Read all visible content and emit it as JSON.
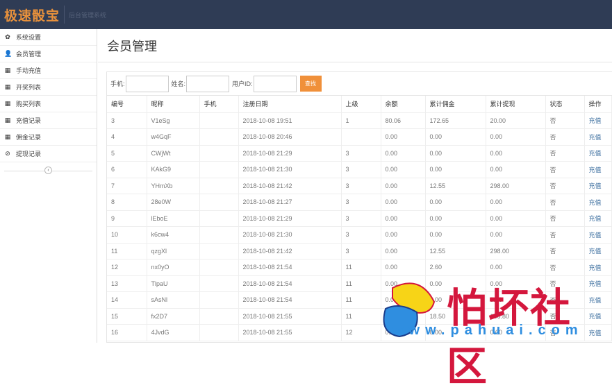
{
  "header": {
    "logo": "极速骰宝",
    "subtitle": "后台管理系统"
  },
  "sidebar": {
    "items": [
      {
        "icon": "gear-icon",
        "glyph": "✿",
        "label": "系统设置"
      },
      {
        "icon": "user-icon",
        "glyph": "👤",
        "label": "会员管理"
      },
      {
        "icon": "calendar-icon",
        "glyph": "▦",
        "label": "手动充值"
      },
      {
        "icon": "calendar-icon",
        "glyph": "▦",
        "label": "开奖列表"
      },
      {
        "icon": "calendar-icon",
        "glyph": "▦",
        "label": "购买列表"
      },
      {
        "icon": "calendar-icon",
        "glyph": "▦",
        "label": "充值记录"
      },
      {
        "icon": "calendar-icon",
        "glyph": "▦",
        "label": "佣金记录"
      },
      {
        "icon": "ban-icon",
        "glyph": "⊘",
        "label": "提现记录"
      }
    ],
    "collapse_glyph": "‹"
  },
  "page": {
    "title": "会员管理"
  },
  "search": {
    "phone_label": "手机:",
    "name_label": "姓名:",
    "uid_label": "用户ID:",
    "phone_value": "",
    "name_value": "",
    "uid_value": "",
    "button": "查找"
  },
  "table": {
    "headers": [
      "编号",
      "昵称",
      "手机",
      "注册日期",
      "上级",
      "余额",
      "累计佣金",
      "累计提现",
      "状态",
      "操作"
    ],
    "rows": [
      [
        "3",
        "V1eSg",
        "",
        "2018-10-08 19:51",
        "1",
        "80.06",
        "172.65",
        "20.00",
        "否",
        "充值"
      ],
      [
        "4",
        "w4GqF",
        "",
        "2018-10-08 20:46",
        "",
        "0.00",
        "0.00",
        "0.00",
        "否",
        "充值"
      ],
      [
        "5",
        "CWjWt",
        "",
        "2018-10-08 21:29",
        "3",
        "0.00",
        "0.00",
        "0.00",
        "否",
        "充值"
      ],
      [
        "6",
        "KAkG9",
        "",
        "2018-10-08 21:30",
        "3",
        "0.00",
        "0.00",
        "0.00",
        "否",
        "充值"
      ],
      [
        "7",
        "YHmXb",
        "",
        "2018-10-08 21:42",
        "3",
        "0.00",
        "12.55",
        "298.00",
        "否",
        "充值"
      ],
      [
        "8",
        "28e0W",
        "",
        "2018-10-08 21:27",
        "3",
        "0.00",
        "0.00",
        "0.00",
        "否",
        "充值"
      ],
      [
        "9",
        "lEboE",
        "",
        "2018-10-08 21:29",
        "3",
        "0.00",
        "0.00",
        "0.00",
        "否",
        "充值"
      ],
      [
        "10",
        "k6cw4",
        "",
        "2018-10-08 21:30",
        "3",
        "0.00",
        "0.00",
        "0.00",
        "否",
        "充值"
      ],
      [
        "11",
        "qzgXl",
        "",
        "2018-10-08 21:42",
        "3",
        "0.00",
        "12.55",
        "298.00",
        "否",
        "充值"
      ],
      [
        "12",
        "nx0yO",
        "",
        "2018-10-08 21:54",
        "11",
        "0.00",
        "2.60",
        "0.00",
        "否",
        "充值"
      ],
      [
        "13",
        "TlpaU",
        "",
        "2018-10-08 21:54",
        "11",
        "0.00",
        "0.00",
        "0.00",
        "否",
        "充值"
      ],
      [
        "14",
        "sAsNl",
        "",
        "2018-10-08 21:54",
        "11",
        "0.00",
        "0.00",
        "0.00",
        "否",
        "充值"
      ],
      [
        "15",
        "fx2D7",
        "",
        "2018-10-08 21:55",
        "11",
        "0.00",
        "18.50",
        "136.80",
        "否",
        "充值"
      ],
      [
        "16",
        "4JvdG",
        "",
        "2018-10-08 21:55",
        "12",
        "0.00",
        "0.00",
        "0.00",
        "否",
        "充值"
      ]
    ]
  },
  "watermark": {
    "text": "怕坏社区",
    "url": "www.pahuai.com"
  }
}
